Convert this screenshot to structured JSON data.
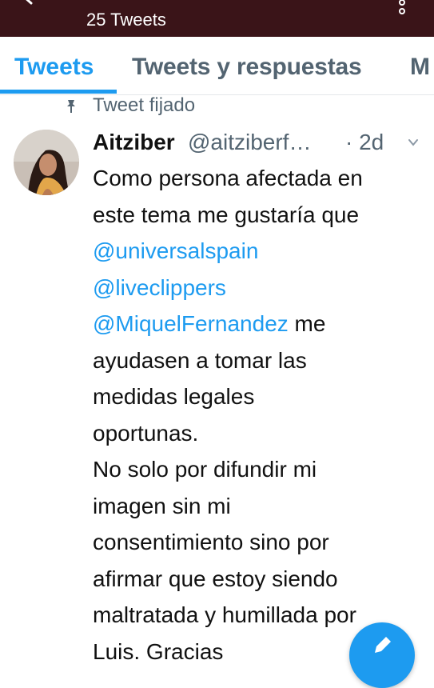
{
  "header": {
    "tweet_count": "25 Tweets",
    "back_icon": "arrow-left-icon",
    "overflow_icon": "more-vertical-icon",
    "background": "#3a1418"
  },
  "tabs": [
    {
      "label": "Tweets",
      "selected": true
    },
    {
      "label": "Tweets y respuestas",
      "selected": false
    },
    {
      "label": "M",
      "selected": false
    }
  ],
  "pinned": {
    "label": "Tweet fijado",
    "icon": "pin-icon"
  },
  "tweet": {
    "display_name": "Aitziber",
    "handle": "@aitziberf…",
    "time": "· 2d",
    "menu_icon": "chevron-down-icon",
    "body": {
      "line1": "Como persona afectada en",
      "line2": "este tema me gustaría que",
      "mention1": "@universalspain",
      "mention2": "@liveclippers",
      "mention3": "@MiquelFernandez",
      "line5_rest": " me",
      "line6": "ayudasen a tomar las",
      "line7": "medidas legales",
      "line8": "oportunas.",
      "line9": "No solo por difundir mi",
      "line10": "imagen sin mi",
      "line11": "consentimiento sino por",
      "line12": "afirmar que estoy siendo",
      "line13": "maltratada y humillada por",
      "line14": "Luis. Gracias"
    }
  },
  "fab": {
    "icon": "compose-icon"
  },
  "colors": {
    "accent": "#1d9bf0",
    "secondary_text": "#536471",
    "primary_text": "#111111"
  }
}
